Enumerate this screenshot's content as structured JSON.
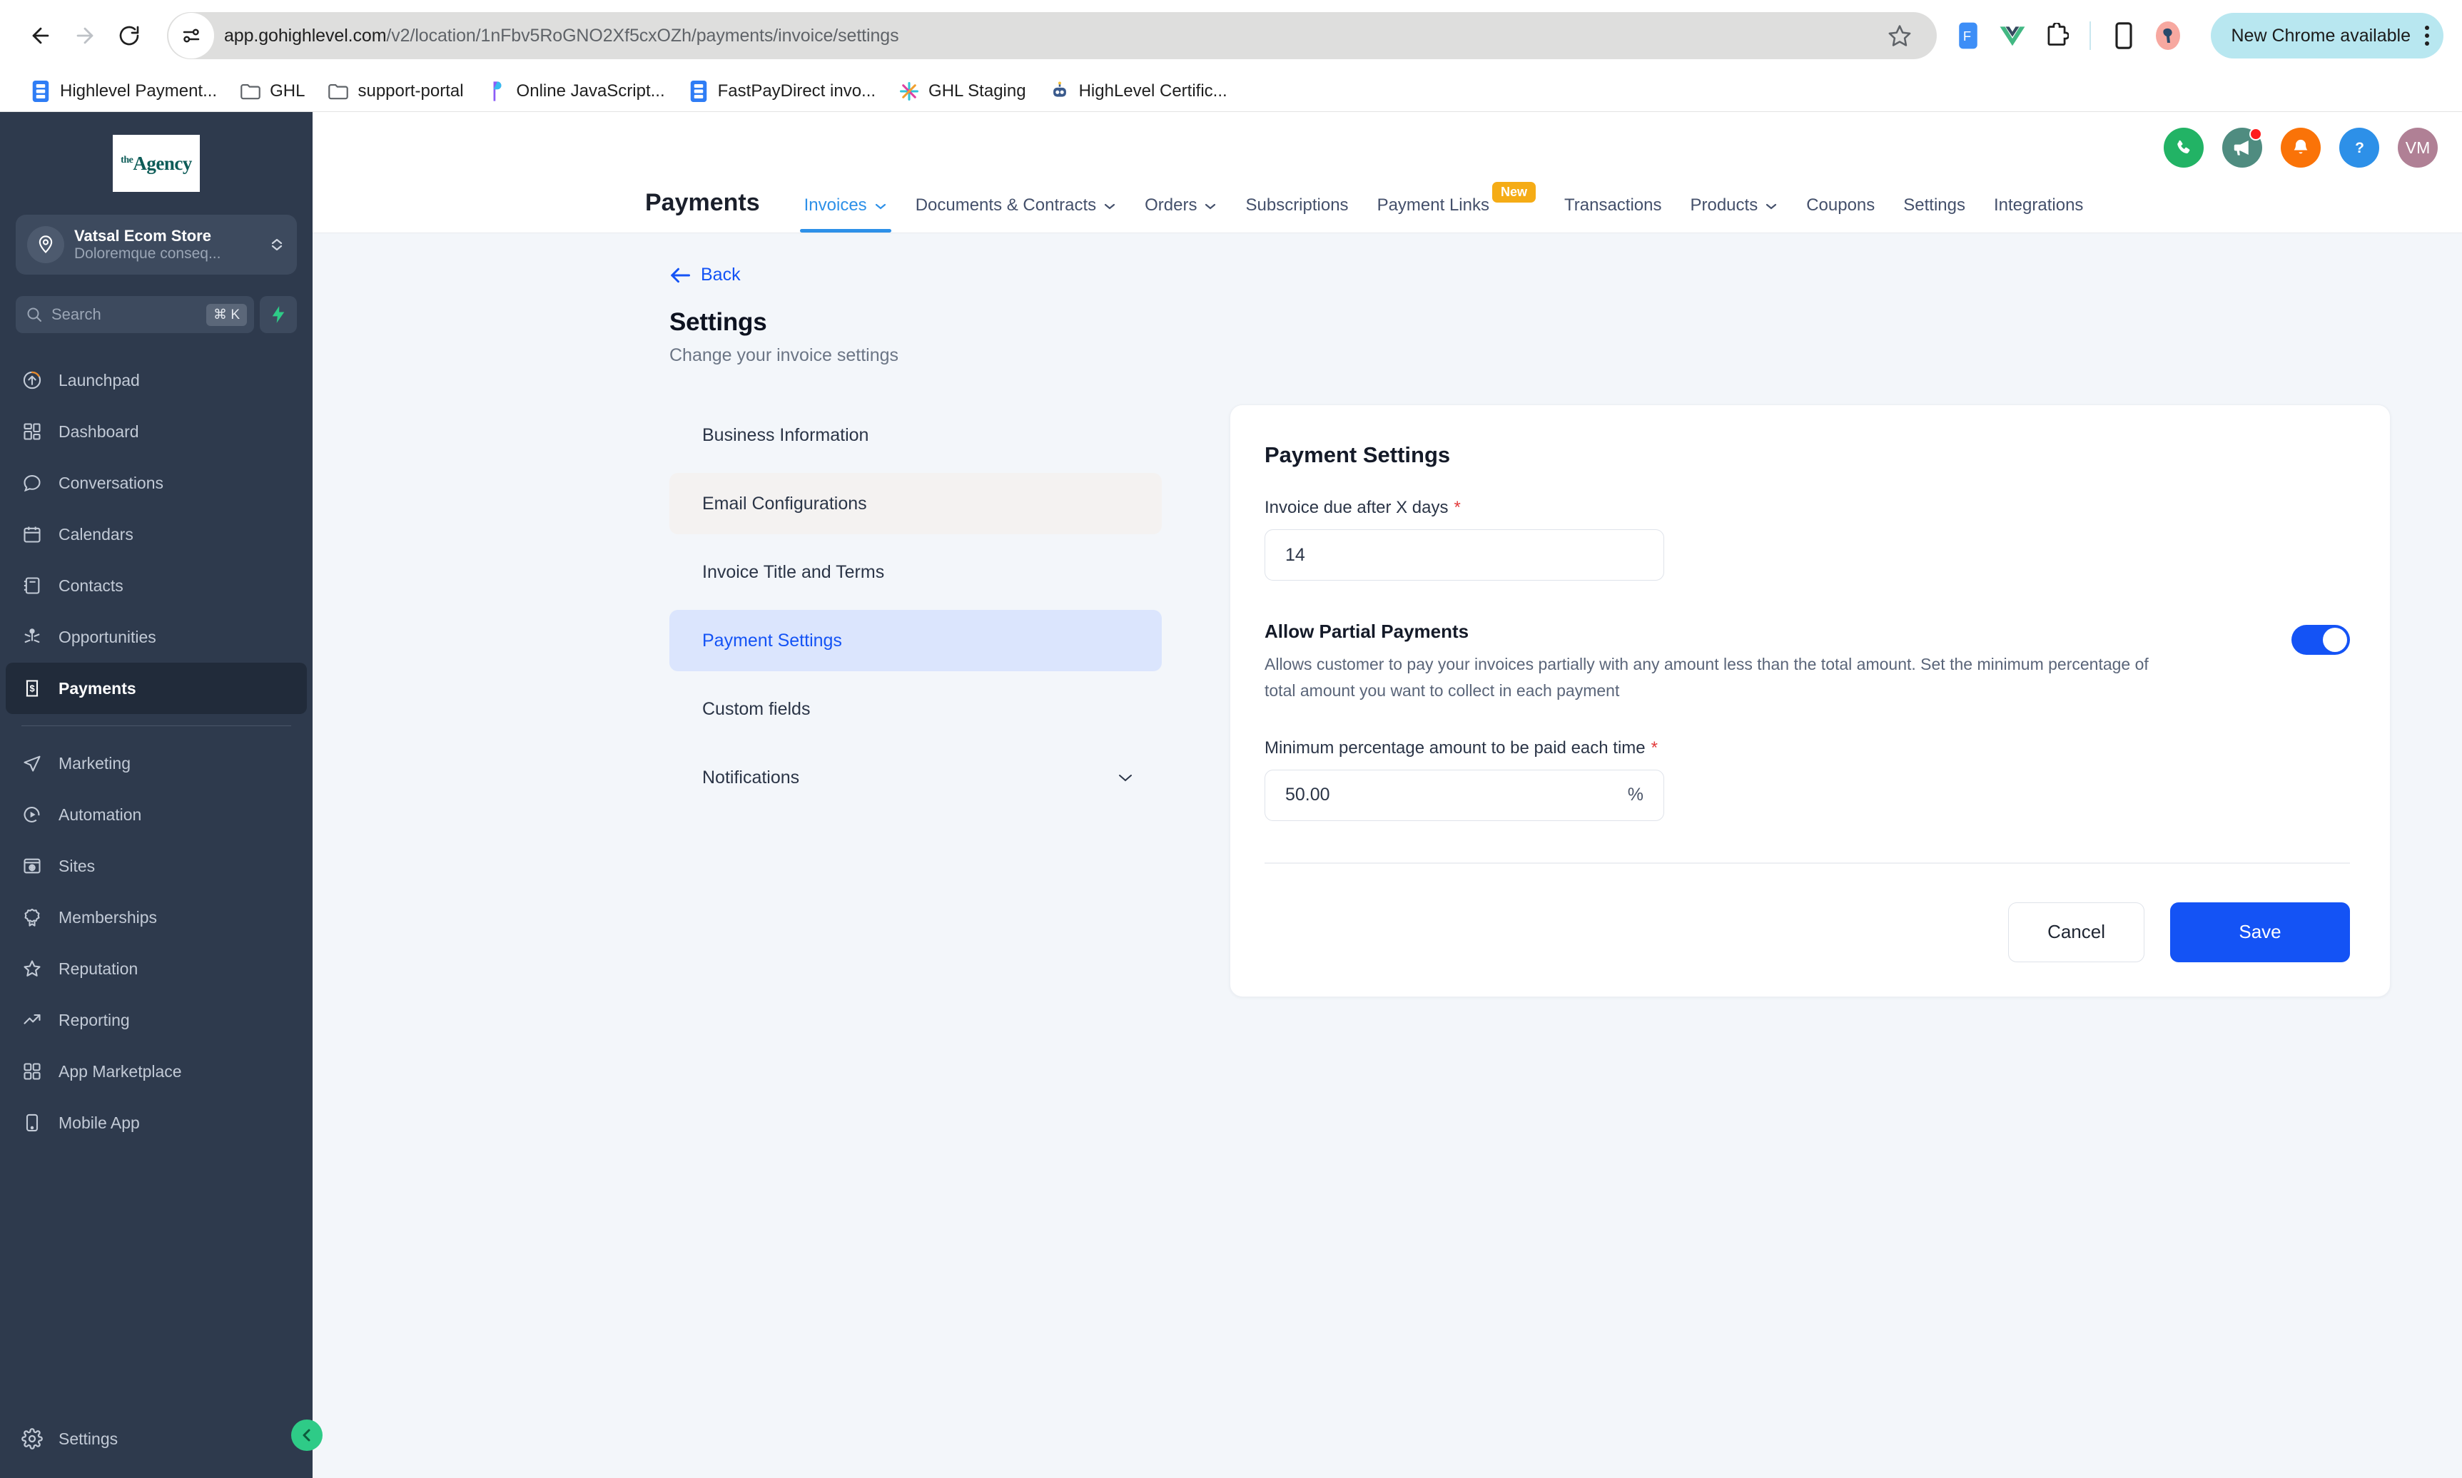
{
  "browser": {
    "url_host": "app.gohighlevel.com",
    "url_path": "/v2/location/1nFbv5RoGNO2Xf5cxOZh/payments/invoice/settings",
    "update_pill": "New Chrome available",
    "bookmarks": [
      {
        "label": "Highlevel Payment...",
        "icon": "blue-doc-icon"
      },
      {
        "label": "GHL",
        "icon": "folder-icon"
      },
      {
        "label": "support-portal",
        "icon": "folder-icon"
      },
      {
        "label": "Online JavaScript...",
        "icon": "purple-p-icon"
      },
      {
        "label": "FastPayDirect invo...",
        "icon": "blue-doc-icon"
      },
      {
        "label": "GHL Staging",
        "icon": "sparkle-icon"
      },
      {
        "label": "HighLevel Certific...",
        "icon": "robot-icon"
      }
    ]
  },
  "sidebar": {
    "logo_sup": "the",
    "logo_name": "Agency",
    "location_name": "Vatsal Ecom Store",
    "location_sub": "Doloremque conseq...",
    "search_placeholder": "Search",
    "search_shortcut": "⌘ K",
    "items": [
      {
        "label": "Launchpad",
        "icon": "rocket-launch-icon",
        "active": false
      },
      {
        "label": "Dashboard",
        "icon": "dashboard-grid-icon",
        "active": false
      },
      {
        "label": "Conversations",
        "icon": "chat-bubble-icon",
        "active": false
      },
      {
        "label": "Calendars",
        "icon": "calendar-icon",
        "active": false
      },
      {
        "label": "Contacts",
        "icon": "contacts-book-icon",
        "active": false
      },
      {
        "label": "Opportunities",
        "icon": "opportunities-icon",
        "active": false
      },
      {
        "label": "Payments",
        "icon": "payments-receipt-icon",
        "active": true
      }
    ],
    "items2": [
      {
        "label": "Marketing",
        "icon": "paper-plane-icon",
        "active": false
      },
      {
        "label": "Automation",
        "icon": "play-circle-icon",
        "active": false
      },
      {
        "label": "Sites",
        "icon": "browser-globe-icon",
        "active": false
      },
      {
        "label": "Memberships",
        "icon": "award-badge-icon",
        "active": false
      },
      {
        "label": "Reputation",
        "icon": "star-icon",
        "active": false
      },
      {
        "label": "Reporting",
        "icon": "trend-up-icon",
        "active": false
      },
      {
        "label": "App Marketplace",
        "icon": "grid-apps-icon",
        "active": false
      },
      {
        "label": "Mobile App",
        "icon": "mobile-phone-icon",
        "active": false
      }
    ],
    "bottom_item": {
      "label": "Settings",
      "icon": "gear-icon"
    },
    "collapse_icon": "chevron-left-icon"
  },
  "topbar": {
    "title": "Payments",
    "tabs": [
      {
        "label": "Invoices",
        "caret": true,
        "active": true,
        "badge": null
      },
      {
        "label": "Documents & Contracts",
        "caret": true,
        "active": false,
        "badge": null
      },
      {
        "label": "Orders",
        "caret": true,
        "active": false,
        "badge": null
      },
      {
        "label": "Subscriptions",
        "caret": false,
        "active": false,
        "badge": null
      },
      {
        "label": "Payment Links",
        "caret": false,
        "active": false,
        "badge": "New"
      },
      {
        "label": "Transactions",
        "caret": false,
        "active": false,
        "badge": null
      },
      {
        "label": "Products",
        "caret": true,
        "active": false,
        "badge": null
      },
      {
        "label": "Coupons",
        "caret": false,
        "active": false,
        "badge": null
      },
      {
        "label": "Settings",
        "caret": false,
        "active": false,
        "badge": null
      },
      {
        "label": "Integrations",
        "caret": false,
        "active": false,
        "badge": null
      }
    ],
    "actions": [
      {
        "icon": "phone-icon",
        "color": "#22b365",
        "dot": false
      },
      {
        "icon": "megaphone-icon",
        "color": "#4f8c80",
        "dot": true
      },
      {
        "icon": "bell-icon",
        "color": "#fa7308",
        "dot": false
      },
      {
        "icon": "help-question-icon",
        "color": "#2d90e8",
        "dot": false
      }
    ],
    "avatar_initials": "VM"
  },
  "page": {
    "back_label": "Back",
    "title": "Settings",
    "subtitle": "Change your invoice settings"
  },
  "settings_menu": [
    {
      "label": "Business Information",
      "state": "normal",
      "caret": false
    },
    {
      "label": "Email Configurations",
      "state": "hover",
      "caret": false
    },
    {
      "label": "Invoice Title and Terms",
      "state": "normal",
      "caret": false
    },
    {
      "label": "Payment Settings",
      "state": "active",
      "caret": false
    },
    {
      "label": "Custom fields",
      "state": "normal",
      "caret": false
    },
    {
      "label": "Notifications",
      "state": "normal",
      "caret": true
    }
  ],
  "card": {
    "title": "Payment Settings",
    "due_days_label": "Invoice due after X days",
    "due_days_required": "*",
    "due_days_value": "14",
    "partial_title": "Allow Partial Payments",
    "partial_desc": "Allows customer to pay your invoices partially with any amount less than the total amount. Set the minimum percentage of total amount you want to collect in each payment",
    "partial_enabled": true,
    "min_pct_label": "Minimum percentage amount to be paid each time",
    "min_pct_required": "*",
    "min_pct_value": "50.00",
    "min_pct_suffix": "%",
    "cancel_label": "Cancel",
    "save_label": "Save"
  },
  "colors": {
    "accent_blue": "#1453f5",
    "tab_blue": "#2d90e8",
    "sidebar_bg": "#2e3a4d",
    "badge_amber": "#f5ac16",
    "collapse_green": "#2ecb87"
  }
}
